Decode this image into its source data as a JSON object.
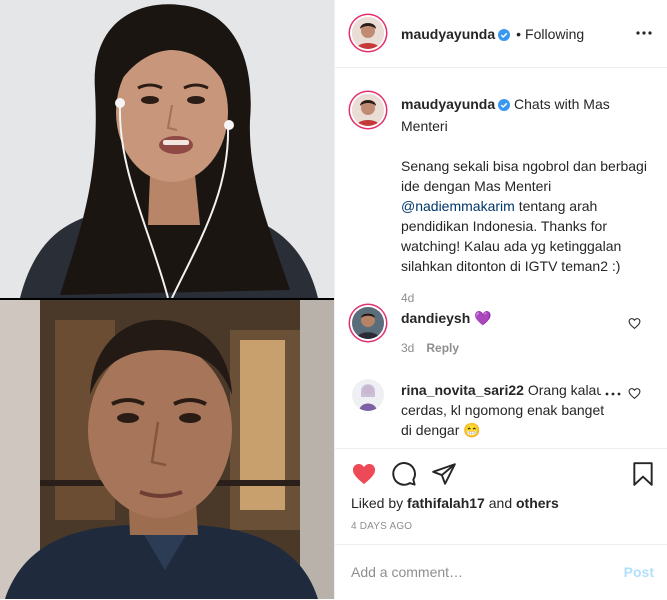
{
  "header": {
    "username": "maudyayunda",
    "follow_status": "Following",
    "separator": "•"
  },
  "caption": {
    "username": "maudyayunda",
    "title": "Chats with Mas Menteri",
    "body_1": "Senang sekali bisa ngobrol dan berbagi ide dengan Mas Menteri",
    "mention": "@nadiemmakarim",
    "body_2": "tentang arah pendidikan Indonesia. Thanks for watching! Kalau ada yg ketinggalan silahkan ditonton di IGTV teman2 :)",
    "age": "4d"
  },
  "comments": [
    {
      "username": "dandieysh",
      "text": "💜",
      "age": "3d",
      "reply_label": "Reply"
    },
    {
      "username": "rina_novita_sari22",
      "text": "Orang kalau cerdas, kl ngomong enak banget di dengar 😁"
    }
  ],
  "likes": {
    "prefix": "Liked by",
    "user": "fathifalah17",
    "joiner": "and",
    "others": "others"
  },
  "posted": "4 DAYS AGO",
  "add_comment": {
    "placeholder": "Add a comment…",
    "post_label": "Post"
  },
  "colors": {
    "like_red": "#ed4956",
    "verified_blue": "#3897f0",
    "post_disabled": "#b2dffc",
    "mention": "#00376b"
  }
}
